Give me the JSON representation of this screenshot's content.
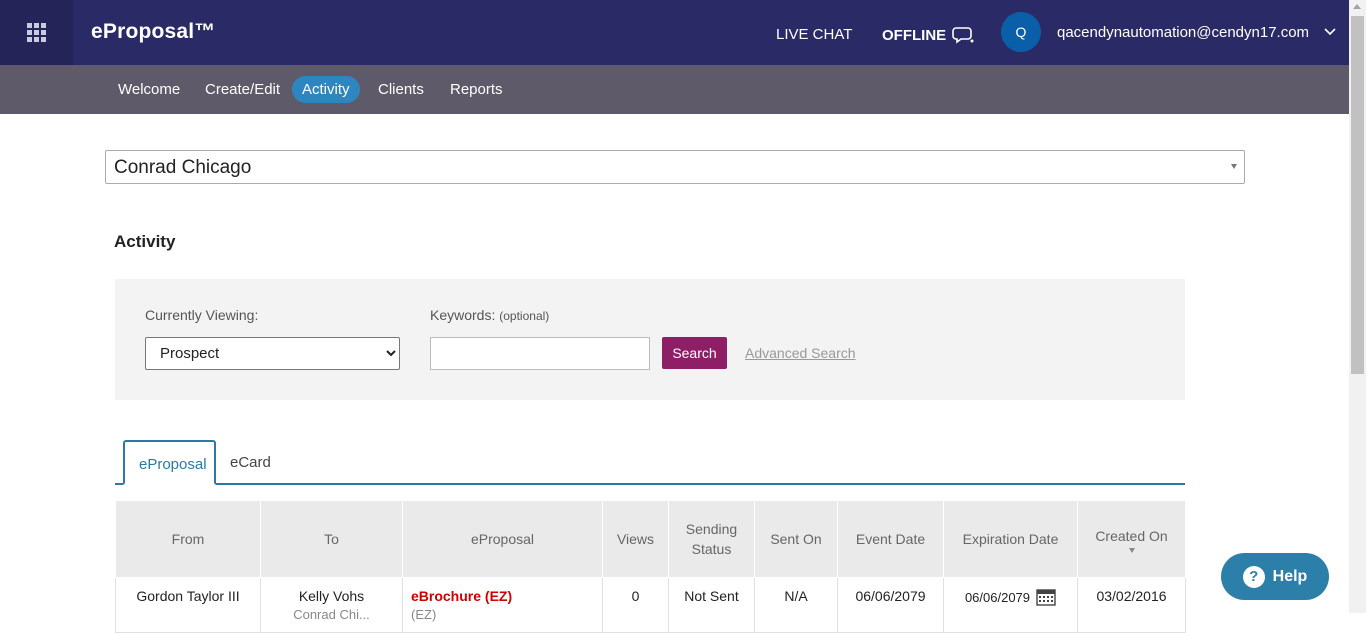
{
  "header": {
    "brand": "eProposal™",
    "live_chat": "LIVE CHAT",
    "offline": "OFFLINE",
    "avatar_initial": "Q",
    "user_email": "qacendynautomation@cendyn17.com"
  },
  "nav": {
    "items": [
      "Welcome",
      "Create/Edit",
      "Activity",
      "Clients",
      "Reports"
    ],
    "active": "Activity"
  },
  "property_select": {
    "value": "Conrad Chicago"
  },
  "page_title": "Activity",
  "filters": {
    "viewing_label": "Currently Viewing:",
    "viewing_value": "Prospect",
    "keywords_label": "Keywords:",
    "keywords_optional": "(optional)",
    "keywords_value": "",
    "search_label": "Search",
    "advanced_search": "Advanced Search"
  },
  "tabs": [
    "eProposal",
    "eCard"
  ],
  "table": {
    "headers": [
      "From",
      "To",
      "eProposal",
      "Views",
      "Sending Status",
      "Sent On",
      "Event Date",
      "Expiration Date",
      "Created On"
    ],
    "rows": [
      {
        "from": "Gordon Taylor III",
        "to": "Kelly Vohs",
        "to_sub": "Conrad Chi...",
        "eproposal": "eBrochure (EZ)",
        "eproposal_sub": "(EZ)",
        "views": "0",
        "sending_status": "Not Sent",
        "sent_on": "N/A",
        "event_date": "06/06/2079",
        "expiration_date": "06/06/2079",
        "created_on": "03/02/2016"
      }
    ]
  },
  "help": {
    "label": "Help"
  },
  "colors": {
    "topbar": "#2a2a66",
    "navbar": "#5e5a6a",
    "accent": "#2e86c1",
    "search_button": "#8e1f66",
    "link_red": "#d00000"
  }
}
